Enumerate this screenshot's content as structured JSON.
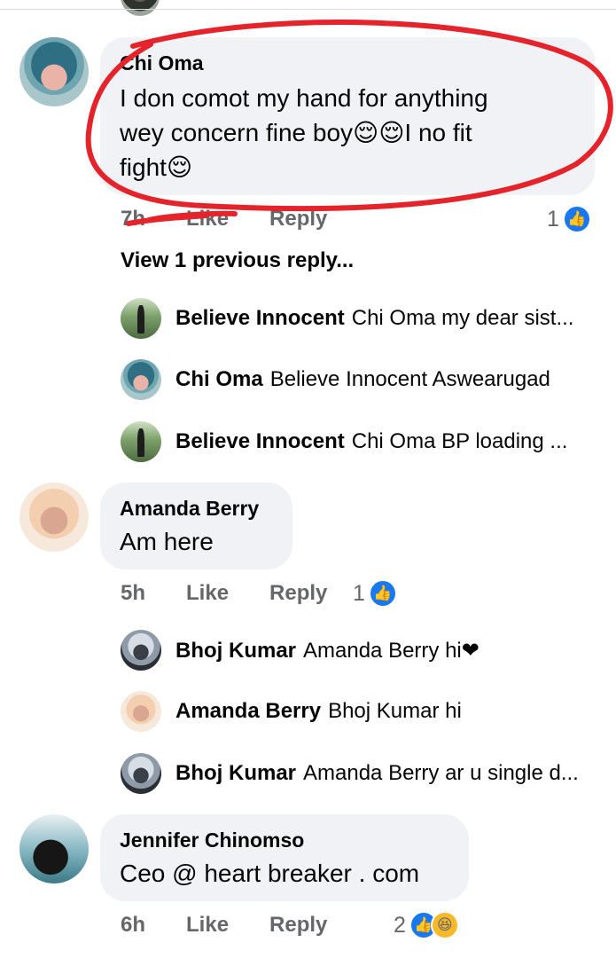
{
  "comments": [
    {
      "name": "Chi Oma",
      "text_line1": "I don comot my hand for anything",
      "text_line2": "wey concern fine boy😌😌I no fit",
      "text_line3": "fight😌",
      "time": "7h",
      "like": "Like",
      "reply": "Reply",
      "reaction_count": "1",
      "view_more": "View 1 previous reply...",
      "replies": [
        {
          "name": "Believe Innocent",
          "text": "Chi Oma  my dear sist..."
        },
        {
          "name": "Chi Oma",
          "text": "Believe Innocent Aswearugad"
        },
        {
          "name": "Believe Innocent",
          "text": "Chi Oma  BP loading ..."
        }
      ]
    },
    {
      "name": "Amanda Berry",
      "text": "Am here",
      "time": "5h",
      "like": "Like",
      "reply": "Reply",
      "reaction_count": "1",
      "replies": [
        {
          "name": "Bhoj Kumar",
          "text": "Amanda Berry hi❤"
        },
        {
          "name": "Amanda Berry",
          "text": "Bhoj Kumar hi"
        },
        {
          "name": "Bhoj Kumar",
          "text": "Amanda Berry ar u single d..."
        }
      ]
    },
    {
      "name": "Jennifer Chinomso",
      "text": "Ceo @ heart breaker . com",
      "time": "6h",
      "like": "Like",
      "reply": "Reply",
      "reaction_count": "2"
    }
  ],
  "icons": {
    "like": "like-thumb-icon",
    "haha": "haha-emoji-icon"
  },
  "colors": {
    "like_blue": "#1877f2",
    "meta_gray": "#65676b",
    "bubble_bg": "#f0f2f5",
    "annotation_red": "#e5232a"
  }
}
